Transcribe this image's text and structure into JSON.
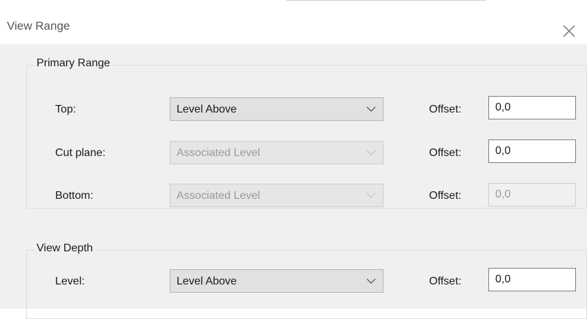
{
  "window": {
    "title": "View Range",
    "close_icon": "close-icon"
  },
  "primary_range": {
    "label": "Primary Range",
    "rows": [
      {
        "label": "Top:",
        "select": "Level Above",
        "select_enabled": true,
        "offset_label": "Offset:",
        "offset_value": "0,0",
        "offset_enabled": true
      },
      {
        "label": "Cut plane:",
        "select": "Associated Level",
        "select_enabled": false,
        "offset_label": "Offset:",
        "offset_value": "0,0",
        "offset_enabled": true
      },
      {
        "label": "Bottom:",
        "select": "Associated Level",
        "select_enabled": false,
        "offset_label": "Offset:",
        "offset_value": "0,0",
        "offset_enabled": false
      }
    ]
  },
  "view_depth": {
    "label": "View Depth",
    "rows": [
      {
        "label": "Level:",
        "select": "Level Above",
        "select_enabled": true,
        "offset_label": "Offset:",
        "offset_value": "0,0",
        "offset_enabled": true
      }
    ]
  },
  "icons": {
    "dropdown": "chevron-down-icon",
    "close": "close-icon"
  }
}
